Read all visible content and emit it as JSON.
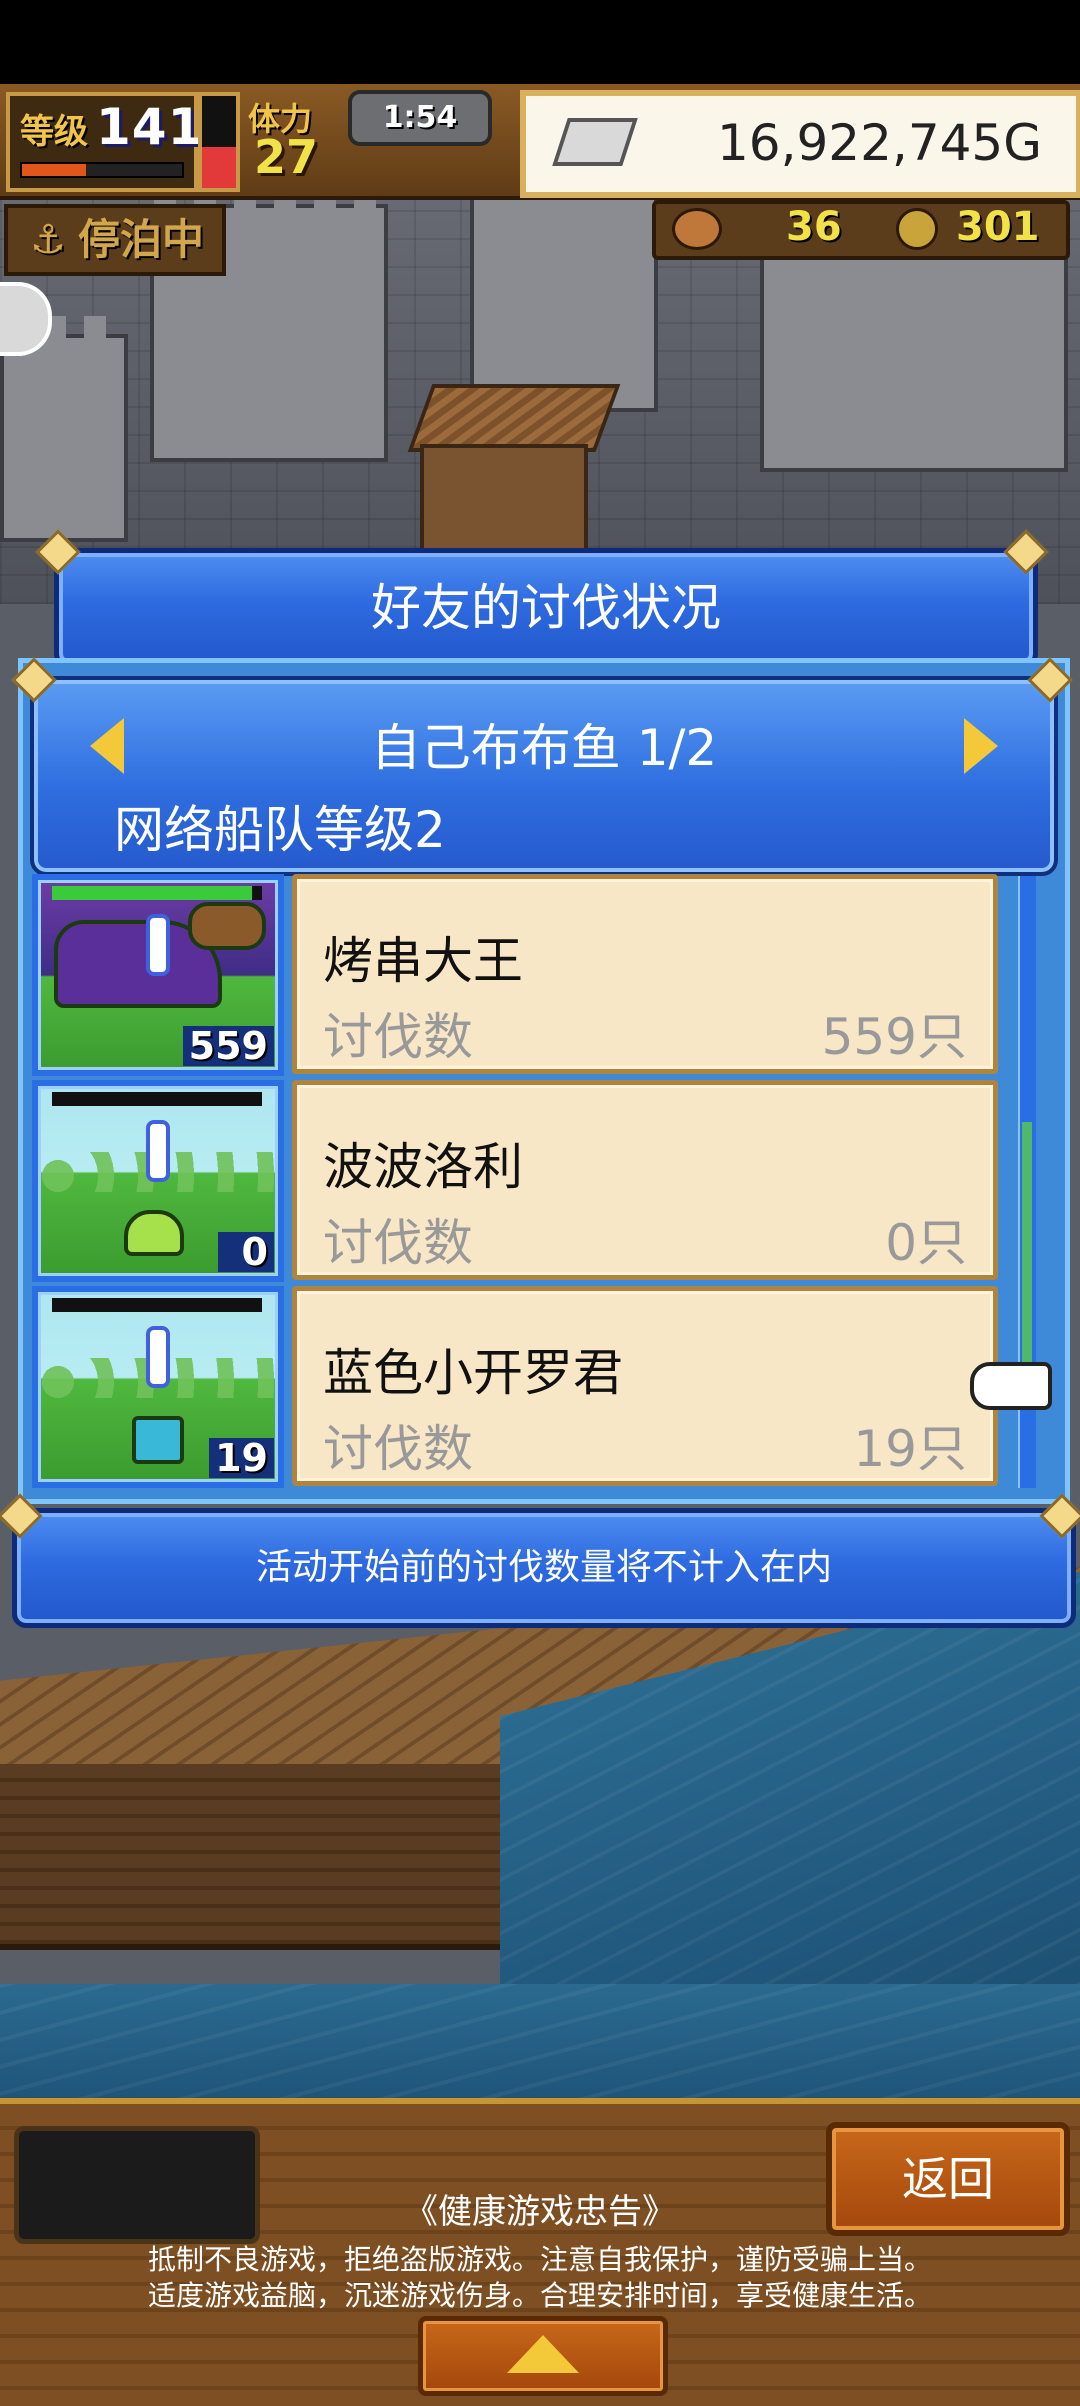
{
  "hud": {
    "level_label": "等级",
    "level_value": "141",
    "level_exp_pct": 40,
    "stamina_pct": 45,
    "stamina_label": "体力",
    "stamina_value": "27",
    "timer": "1:54",
    "money": "16,922,745G",
    "anchor_status": "停泊中",
    "resource_1": "36",
    "resource_2": "301"
  },
  "dialog": {
    "title": "好友的讨伐状况",
    "group_title": "自己布布鱼 1/2",
    "fleet_level": "网络船队等级2",
    "rows": [
      {
        "name": "烤串大王",
        "label": "讨伐数",
        "count": "559只",
        "badge": "559",
        "hp_pct": 95
      },
      {
        "name": "波波洛利",
        "label": "讨伐数",
        "count": "0只",
        "badge": "0",
        "hp_pct": 0
      },
      {
        "name": "蓝色小开罗君",
        "label": "讨伐数",
        "count": "19只",
        "badge": "19",
        "hp_pct": 0
      }
    ],
    "scroll_fraction": 0.7,
    "notice": "活动开始前的讨伐数量将不计入在内"
  },
  "bottom": {
    "back_label": "返回",
    "health_title": "《健康游戏忠告》",
    "health_line_1": "抵制不良游戏，拒绝盗版游戏。注意自我保护，谨防受骗上当。",
    "health_line_2": "适度游戏益脑，沉迷游戏伤身。合理安排时间，享受健康生活。"
  }
}
